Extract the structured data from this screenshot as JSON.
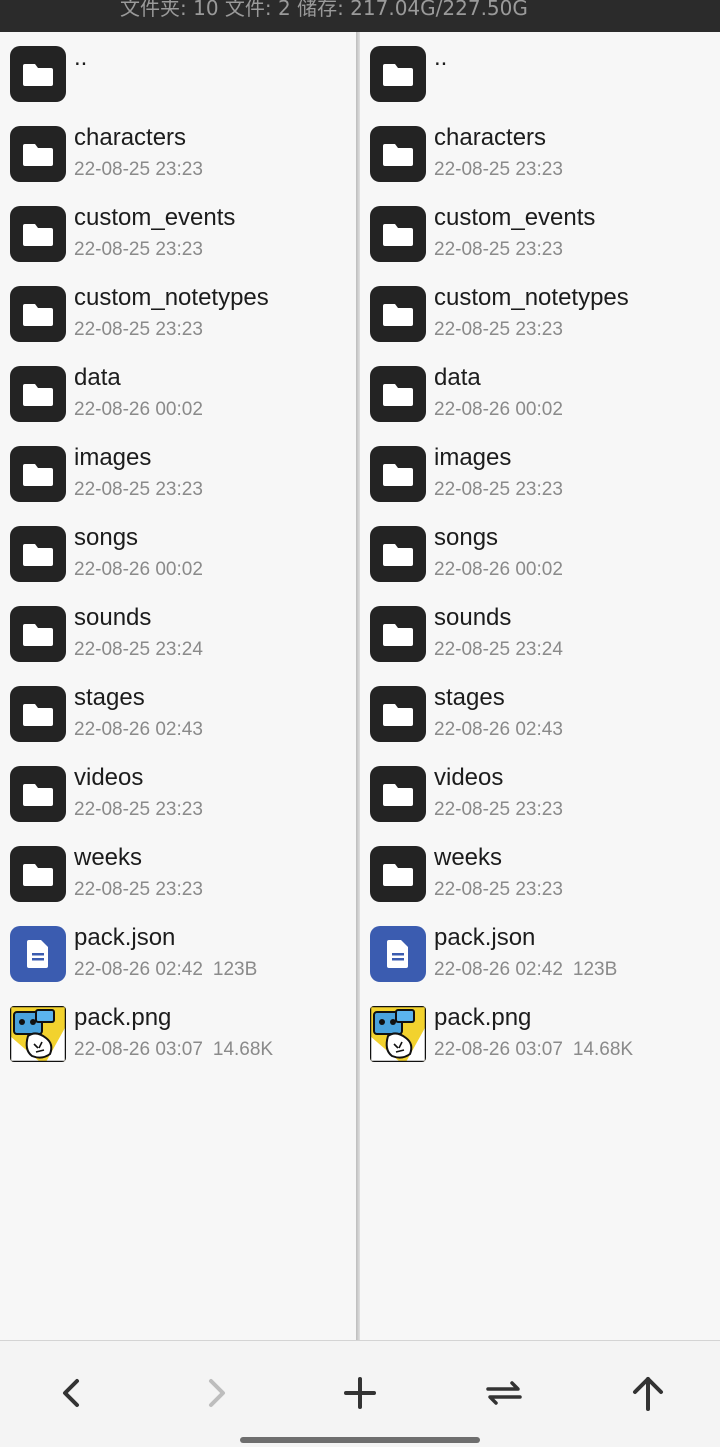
{
  "status_bar": {
    "summary": "文件夹: 10  文件: 2  储存: 217.04G/227.50G"
  },
  "panes": [
    {
      "entries": [
        {
          "type": "folder",
          "name": "..",
          "date": "",
          "size": ""
        },
        {
          "type": "folder",
          "name": "characters",
          "date": "22-08-25 23:23",
          "size": ""
        },
        {
          "type": "folder",
          "name": "custom_events",
          "date": "22-08-25 23:23",
          "size": ""
        },
        {
          "type": "folder",
          "name": "custom_notetypes",
          "date": "22-08-25 23:23",
          "size": ""
        },
        {
          "type": "folder",
          "name": "data",
          "date": "22-08-26 00:02",
          "size": ""
        },
        {
          "type": "folder",
          "name": "images",
          "date": "22-08-25 23:23",
          "size": ""
        },
        {
          "type": "folder",
          "name": "songs",
          "date": "22-08-26 00:02",
          "size": ""
        },
        {
          "type": "folder",
          "name": "sounds",
          "date": "22-08-25 23:24",
          "size": ""
        },
        {
          "type": "folder",
          "name": "stages",
          "date": "22-08-26 02:43",
          "size": ""
        },
        {
          "type": "folder",
          "name": "videos",
          "date": "22-08-25 23:23",
          "size": ""
        },
        {
          "type": "folder",
          "name": "weeks",
          "date": "22-08-25 23:23",
          "size": ""
        },
        {
          "type": "file",
          "name": "pack.json",
          "date": "22-08-26 02:42",
          "size": "123B"
        },
        {
          "type": "image",
          "name": "pack.png",
          "date": "22-08-26 03:07",
          "size": "14.68K"
        }
      ]
    },
    {
      "entries": [
        {
          "type": "folder",
          "name": "..",
          "date": "",
          "size": ""
        },
        {
          "type": "folder",
          "name": "characters",
          "date": "22-08-25 23:23",
          "size": ""
        },
        {
          "type": "folder",
          "name": "custom_events",
          "date": "22-08-25 23:23",
          "size": ""
        },
        {
          "type": "folder",
          "name": "custom_notetypes",
          "date": "22-08-25 23:23",
          "size": ""
        },
        {
          "type": "folder",
          "name": "data",
          "date": "22-08-26 00:02",
          "size": ""
        },
        {
          "type": "folder",
          "name": "images",
          "date": "22-08-25 23:23",
          "size": ""
        },
        {
          "type": "folder",
          "name": "songs",
          "date": "22-08-26 00:02",
          "size": ""
        },
        {
          "type": "folder",
          "name": "sounds",
          "date": "22-08-25 23:24",
          "size": ""
        },
        {
          "type": "folder",
          "name": "stages",
          "date": "22-08-26 02:43",
          "size": ""
        },
        {
          "type": "folder",
          "name": "videos",
          "date": "22-08-25 23:23",
          "size": ""
        },
        {
          "type": "folder",
          "name": "weeks",
          "date": "22-08-25 23:23",
          "size": ""
        },
        {
          "type": "file",
          "name": "pack.json",
          "date": "22-08-26 02:42",
          "size": "123B"
        },
        {
          "type": "image",
          "name": "pack.png",
          "date": "22-08-26 03:07",
          "size": "14.68K"
        }
      ]
    }
  ],
  "toolbar": {
    "buttons": [
      {
        "icon": "chevron-left-icon",
        "enabled": true
      },
      {
        "icon": "chevron-right-icon",
        "enabled": false
      },
      {
        "icon": "plus-icon",
        "enabled": true
      },
      {
        "icon": "swap-arrows-icon",
        "enabled": true
      },
      {
        "icon": "arrow-up-icon",
        "enabled": true
      }
    ]
  },
  "colors": {
    "folder_icon_bg": "#232323",
    "file_icon_bg": "#3b5cb0",
    "enabled_icon": "#333333",
    "disabled_icon": "#bdbdbd"
  }
}
